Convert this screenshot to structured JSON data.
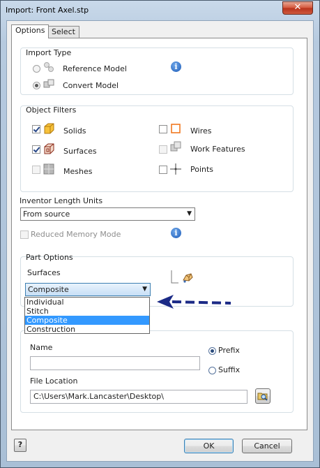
{
  "window": {
    "title": "Import:  Front Axel.stp",
    "close_label": "✕"
  },
  "tabs": [
    {
      "label": "Options",
      "active": true
    },
    {
      "label": "Select",
      "active": false
    }
  ],
  "import_type": {
    "label": "Import Type",
    "options": [
      {
        "label": "Reference Model",
        "checked": false,
        "enabled": false
      },
      {
        "label": "Convert Model",
        "checked": true,
        "enabled": false
      }
    ],
    "info_glyph": "i"
  },
  "object_filters": {
    "label": "Object Filters",
    "items": {
      "solids": {
        "label": "Solids",
        "checked": true,
        "enabled": true
      },
      "surfaces": {
        "label": "Surfaces",
        "checked": true,
        "enabled": true
      },
      "meshes": {
        "label": "Meshes",
        "checked": false,
        "enabled": false
      },
      "wires": {
        "label": "Wires",
        "checked": false,
        "enabled": true
      },
      "work_features": {
        "label": "Work Features",
        "checked": false,
        "enabled": false
      },
      "points": {
        "label": "Points",
        "checked": false,
        "enabled": true
      }
    }
  },
  "length_units": {
    "label": "Inventor Length Units",
    "value": "From source"
  },
  "reduced_memory": {
    "label": "Reduced Memory Mode",
    "checked": false,
    "enabled": false
  },
  "part_options": {
    "label": "Part Options",
    "surfaces_label": "Surfaces",
    "surfaces_value": "Composite",
    "surfaces_options": [
      {
        "label": "Individual",
        "selected": false
      },
      {
        "label": "Stitch",
        "selected": false
      },
      {
        "label": "Composite",
        "selected": true
      },
      {
        "label": "Construction",
        "selected": false
      }
    ]
  },
  "naming": {
    "name_label": "Name",
    "name_value": "",
    "prefix_label": "Prefix",
    "suffix_label": "Suffix",
    "prefix_checked": true,
    "file_location_label": "File Location",
    "file_location_value": "C:\\Users\\Mark.Lancaster\\Desktop\\"
  },
  "footer": {
    "help_glyph": "?",
    "ok_label": "OK",
    "cancel_label": "Cancel"
  },
  "colors": {
    "annotation_arrow": "#1b2a86",
    "selection": "#3399ff",
    "info": "#1e5cb8"
  }
}
